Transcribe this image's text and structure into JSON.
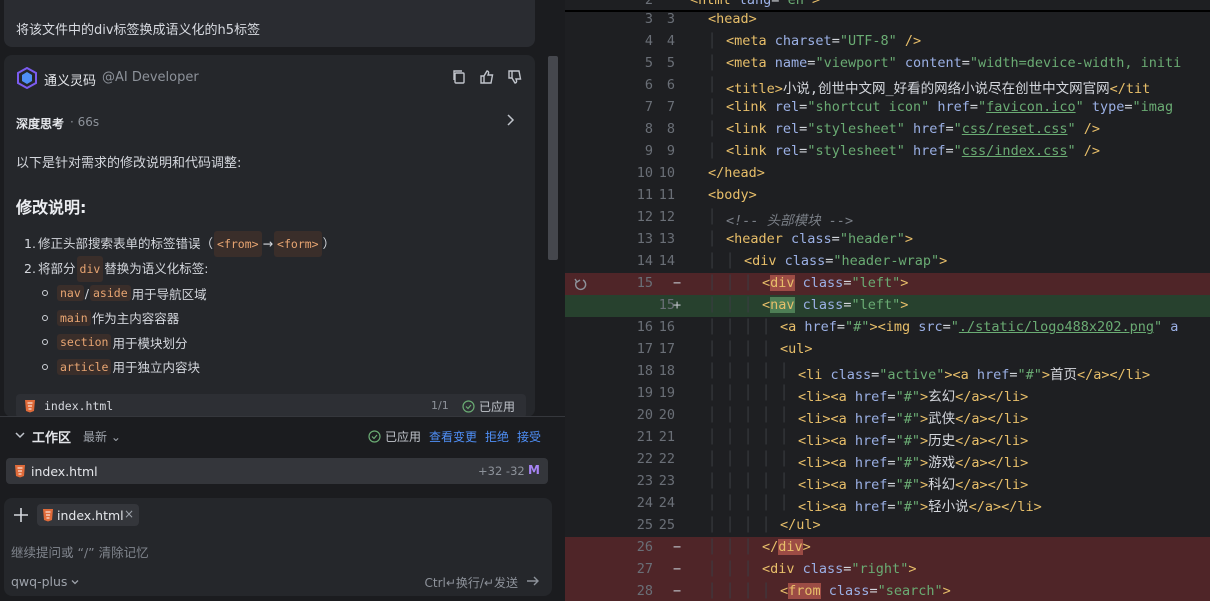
{
  "left": {
    "user_message": "将该文件中的div标签换成语义化的h5标签",
    "assistant": {
      "name": "通义灵码",
      "handle": "@AI Developer",
      "thinking_label": "深度思考",
      "thinking_duration": "· 66s",
      "intro": "以下是针对需求的修改说明和代码调整:",
      "heading": "修改说明:",
      "steps": [
        {
          "num": "1.",
          "text_a": "修正头部搜索表单的标签错误（",
          "code_a": "<from>",
          "arrow": "→",
          "code_b": "<form>",
          "text_b": "）"
        },
        {
          "num": "2.",
          "text_a": "将部分",
          "code_a": "div",
          "text_b": "替换为语义化标签:"
        }
      ],
      "sub_items": [
        {
          "code_a": "nav",
          "sep": "/",
          "code_b": "aside",
          "text": "用于导航区域"
        },
        {
          "code_a": "main",
          "text": "作为主内容容器"
        },
        {
          "code_a": "section",
          "text": "用于模块划分"
        },
        {
          "code_a": "article",
          "text": "用于独立内容块"
        }
      ],
      "file_strip": {
        "name": "index.html",
        "count": "1/1",
        "status": "已应用"
      }
    },
    "workspace": {
      "title": "工作区",
      "filter": "最新",
      "status": "已应用",
      "view_changes": "查看变更",
      "reject": "拒绝",
      "accept": "接受",
      "file": {
        "name": "index.html",
        "diff": "+32 -32",
        "state": "M"
      }
    },
    "input": {
      "chip": "index.html",
      "chip_close": "×",
      "placeholder": "继续提问或 “/” 清除记忆",
      "model": "qwq-plus",
      "hint": "Ctrl↵换行/↵发送"
    }
  },
  "editor": {
    "top_line": {
      "ln1": "2",
      "text": "<html lang=\"en\">"
    },
    "lines": [
      {
        "ln1": "3",
        "ln2": "3",
        "mk": "",
        "kind": "normal",
        "indent": 1,
        "html": "head"
      },
      {
        "ln1": "4",
        "ln2": "4",
        "mk": "",
        "kind": "normal",
        "indent": 2,
        "html": "meta-charset"
      },
      {
        "ln1": "5",
        "ln2": "5",
        "mk": "",
        "kind": "normal",
        "indent": 2,
        "html": "meta-viewport"
      },
      {
        "ln1": "6",
        "ln2": "6",
        "mk": "",
        "kind": "normal",
        "indent": 2,
        "html": "title"
      },
      {
        "ln1": "7",
        "ln2": "7",
        "mk": "",
        "kind": "normal",
        "indent": 2,
        "html": "link-icon"
      },
      {
        "ln1": "8",
        "ln2": "8",
        "mk": "",
        "kind": "normal",
        "indent": 2,
        "html": "link-reset"
      },
      {
        "ln1": "9",
        "ln2": "9",
        "mk": "",
        "kind": "normal",
        "indent": 2,
        "html": "link-index"
      },
      {
        "ln1": "10",
        "ln2": "10",
        "mk": "",
        "kind": "normal",
        "indent": 1,
        "html": "head-close"
      },
      {
        "ln1": "11",
        "ln2": "11",
        "mk": "",
        "kind": "normal",
        "indent": 1,
        "html": "body"
      },
      {
        "ln1": "12",
        "ln2": "12",
        "mk": "",
        "kind": "normal",
        "indent": 2,
        "html": "comment"
      },
      {
        "ln1": "13",
        "ln2": "13",
        "mk": "",
        "kind": "normal",
        "indent": 2,
        "html": "header"
      },
      {
        "ln1": "14",
        "ln2": "14",
        "mk": "",
        "kind": "normal",
        "indent": 3,
        "html": "header-wrap"
      },
      {
        "ln1": "15",
        "ln2": "",
        "mk": "−",
        "kind": "del",
        "indent": 4,
        "html": "div-left"
      },
      {
        "ln1": "",
        "ln2": "15",
        "mk": "+",
        "kind": "add",
        "indent": 4,
        "html": "nav-left"
      },
      {
        "ln1": "16",
        "ln2": "16",
        "mk": "",
        "kind": "normal",
        "indent": 5,
        "html": "a-logo"
      },
      {
        "ln1": "17",
        "ln2": "17",
        "mk": "",
        "kind": "normal",
        "indent": 5,
        "html": "ul"
      },
      {
        "ln1": "18",
        "ln2": "18",
        "mk": "",
        "kind": "normal",
        "indent": 6,
        "html": "li-active"
      },
      {
        "ln1": "19",
        "ln2": "19",
        "mk": "",
        "kind": "normal",
        "indent": 6,
        "html": "li-1"
      },
      {
        "ln1": "20",
        "ln2": "20",
        "mk": "",
        "kind": "normal",
        "indent": 6,
        "html": "li-2"
      },
      {
        "ln1": "21",
        "ln2": "21",
        "mk": "",
        "kind": "normal",
        "indent": 6,
        "html": "li-3"
      },
      {
        "ln1": "22",
        "ln2": "22",
        "mk": "",
        "kind": "normal",
        "indent": 6,
        "html": "li-4"
      },
      {
        "ln1": "23",
        "ln2": "23",
        "mk": "",
        "kind": "normal",
        "indent": 6,
        "html": "li-5"
      },
      {
        "ln1": "24",
        "ln2": "24",
        "mk": "",
        "kind": "normal",
        "indent": 6,
        "html": "li-6"
      },
      {
        "ln1": "25",
        "ln2": "25",
        "mk": "",
        "kind": "normal",
        "indent": 5,
        "html": "ul-close"
      },
      {
        "ln1": "26",
        "ln2": "",
        "mk": "−",
        "kind": "del",
        "indent": 4,
        "html": "div-close"
      },
      {
        "ln1": "27",
        "ln2": "",
        "mk": "−",
        "kind": "del",
        "indent": 4,
        "html": "div-right"
      },
      {
        "ln1": "28",
        "ln2": "",
        "mk": "−",
        "kind": "del",
        "indent": 5,
        "html": "from-search"
      }
    ],
    "strings": {
      "charset": "UTF-8",
      "viewport": "width=device-width, initi",
      "title_text": "小说,创世中文网_好看的网络小说尽在创世中文网官网",
      "title_cut": "</tit",
      "favicon": "favicon.ico",
      "icon_type_cut": "type=\"imag",
      "reset_css": "css/reset.css",
      "index_css": "css/index.css",
      "comment_text": "头部模块",
      "logo_src": "./static/logo488x202.png",
      "nav_items": [
        "首页",
        "玄幻",
        "武侠",
        "历史",
        "游戏",
        "科幻",
        "轻小说"
      ]
    }
  }
}
